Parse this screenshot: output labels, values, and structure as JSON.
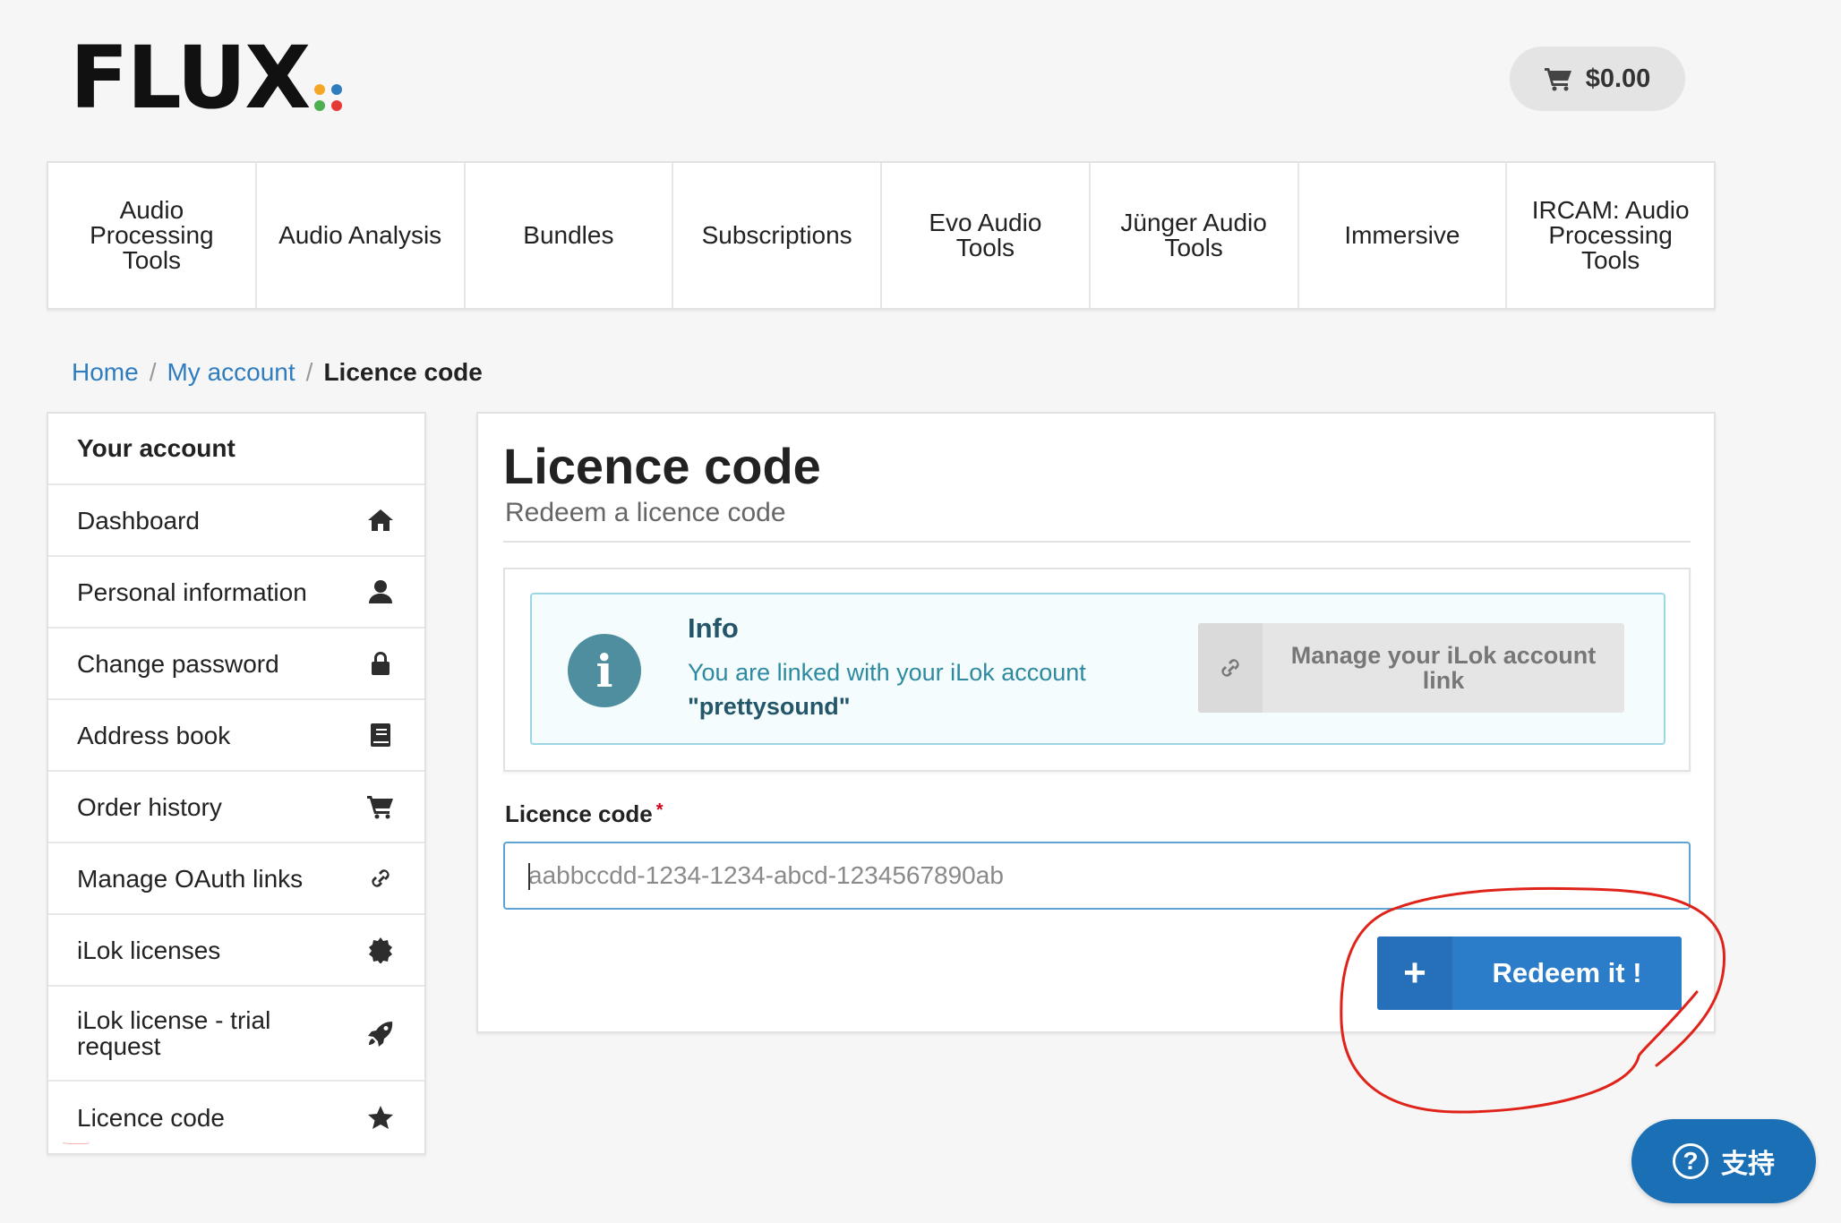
{
  "header": {
    "logo_text": "FLUX",
    "logo_dot_colors": [
      "#f5a623",
      "#2f7dbf",
      "#4caf50",
      "#e53935"
    ],
    "cart_total": "$0.00"
  },
  "nav": {
    "items": [
      {
        "label": "Audio Processing Tools"
      },
      {
        "label": "Audio Analysis"
      },
      {
        "label": "Bundles"
      },
      {
        "label": "Subscriptions"
      },
      {
        "label": "Evo Audio Tools"
      },
      {
        "label": "Jünger Audio Tools"
      },
      {
        "label": "Immersive"
      },
      {
        "label": "IRCAM: Audio Processing Tools"
      }
    ]
  },
  "breadcrumb": {
    "home": "Home",
    "account": "My account",
    "current": "Licence code",
    "separator": "/"
  },
  "sidebar": {
    "title": "Your account",
    "items": [
      {
        "label": "Dashboard",
        "icon": "home-icon"
      },
      {
        "label": "Personal information",
        "icon": "user-icon"
      },
      {
        "label": "Change password",
        "icon": "lock-icon"
      },
      {
        "label": "Address book",
        "icon": "book-icon"
      },
      {
        "label": "Order history",
        "icon": "cart-icon"
      },
      {
        "label": "Manage OAuth links",
        "icon": "link-icon"
      },
      {
        "label": "iLok licenses",
        "icon": "badge-icon"
      },
      {
        "label": "iLok license - trial request",
        "icon": "rocket-icon"
      },
      {
        "label": "Licence code",
        "icon": "star-icon"
      }
    ]
  },
  "main": {
    "title": "Licence code",
    "subtitle": "Redeem a licence code",
    "info": {
      "heading": "Info",
      "text": "You are linked with your iLok account",
      "username": "\"prettysound\"",
      "button_label": "Manage your iLok account link"
    },
    "field": {
      "label": "Licence code",
      "required_mark": "*",
      "placeholder": "aabbccdd-1234-1234-abcd-1234567890ab",
      "value": ""
    },
    "submit": {
      "icon": "+",
      "label": "Redeem it !"
    }
  },
  "support": {
    "label": "支持",
    "icon": "?"
  },
  "colors": {
    "accent": "#2b7cc9",
    "info_bg": "#f4fcfd",
    "info_border": "#9cd7e3",
    "annotation": "#e0231a"
  }
}
